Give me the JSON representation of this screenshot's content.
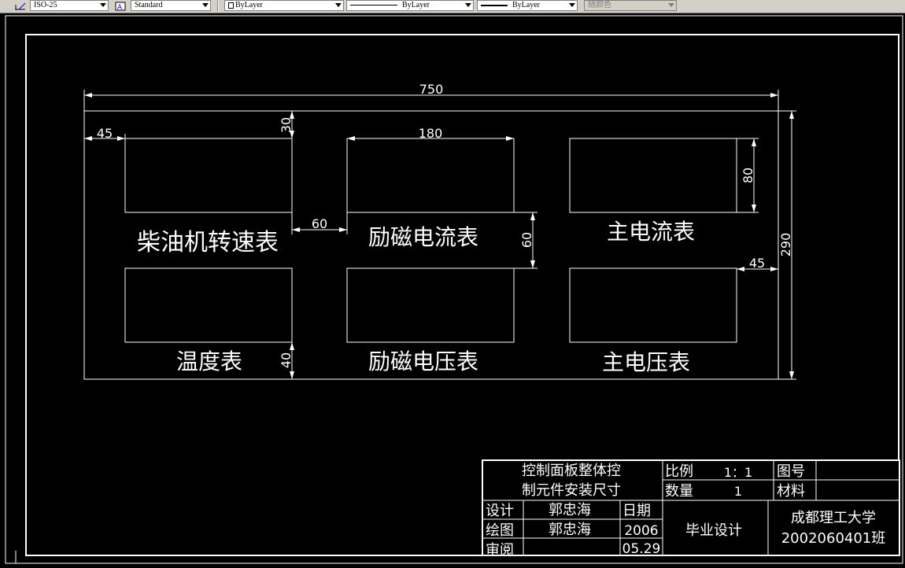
{
  "toolbar": {
    "dimstyle_value": "ISO-25",
    "textstyle_value": "Standard",
    "layer_value": "ByLayer",
    "linetype_value": "ByLayer",
    "lineweight_value": "ByLayer",
    "plotstyle_value": "随颜色"
  },
  "drawing": {
    "dimensions": {
      "overall_width": "750",
      "left_margin": "45",
      "top_margin": "30",
      "meter_width": "180",
      "meter_height": "80",
      "horizontal_gap": "60",
      "vertical_gap": "60",
      "overall_height": "290",
      "right_margin": "45",
      "bottom_margin": "40"
    },
    "labels": {
      "diesel_rpm_meter": "柴油机转速表",
      "excitation_current_meter": "励磁电流表",
      "main_current_meter": "主电流表",
      "temperature_meter": "温度表",
      "excitation_voltage_meter": "励磁电压表",
      "main_voltage_meter": "主电压表"
    }
  },
  "title_block": {
    "drawing_title_line1": "控制面板整体控",
    "drawing_title_line2": "制元件安装尺寸",
    "scale_label": "比例",
    "scale_value": "1：1",
    "drawing_no_label": "图号",
    "quantity_label": "数量",
    "quantity_value": "1",
    "material_label": "材料",
    "design_label": "设计",
    "design_name": "郭忠海",
    "date_label": "日期",
    "draw_label": "绘图",
    "draw_name": "郭忠海",
    "year": "2006",
    "review_label": "审阅",
    "date_value": "05.29",
    "project": "毕业设计",
    "school": "成都理工大学",
    "class": "2002060401班"
  }
}
